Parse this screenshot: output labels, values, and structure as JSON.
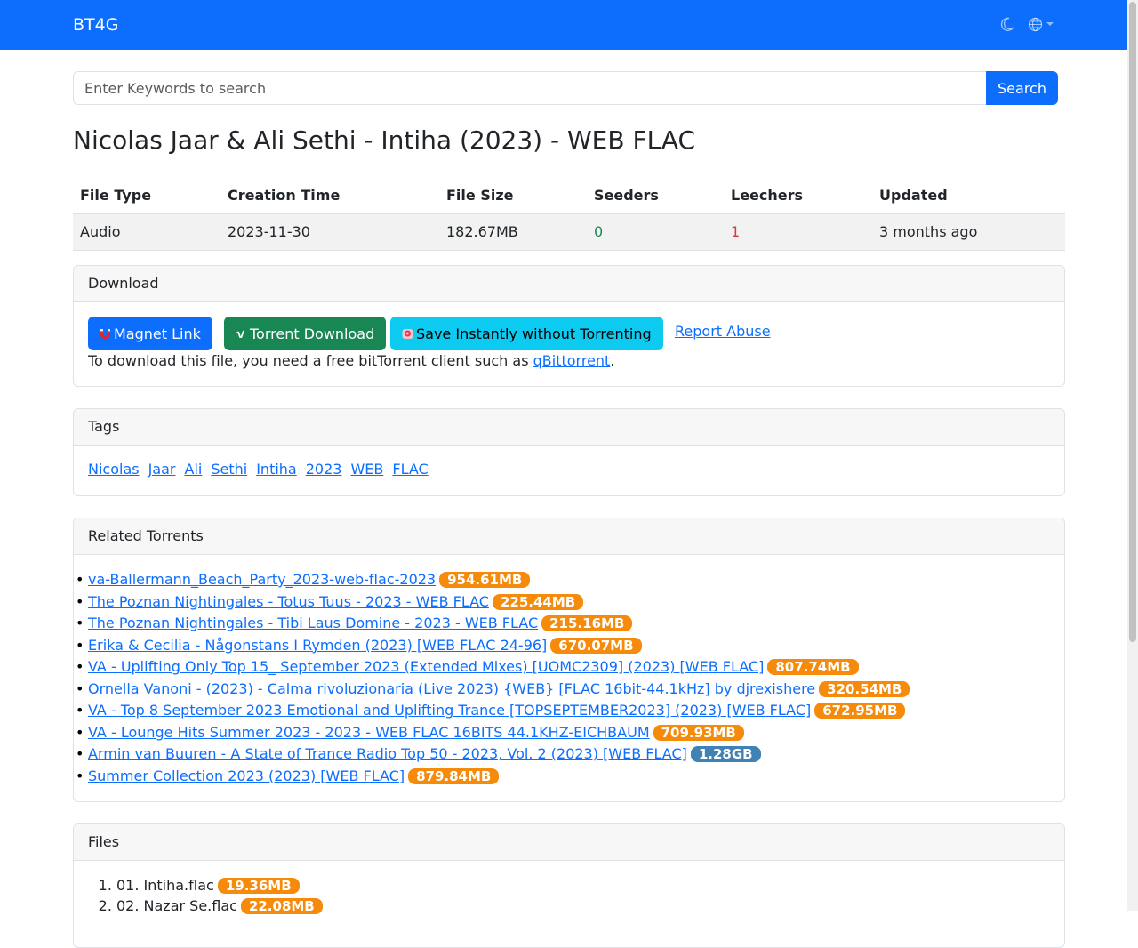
{
  "navbar": {
    "brand": "BT4G",
    "theme_icon": "moon-icon",
    "language_icon": "globe-icon"
  },
  "search": {
    "placeholder": "Enter Keywords to search",
    "value": "",
    "button_label": "Search"
  },
  "title": "Nicolas Jaar & Ali Sethi - Intiha (2023) - WEB FLAC",
  "info_table": {
    "headers": [
      "File Type",
      "Creation Time",
      "File Size",
      "Seeders",
      "Leechers",
      "Updated"
    ],
    "row": [
      "Audio",
      "2023-11-30",
      "182.67MB",
      "0",
      "1",
      "3 months ago"
    ],
    "colors": {
      "seeders": "#198754",
      "leechers": "#dc3545"
    }
  },
  "download": {
    "header": "Download",
    "magnet_label": "Magnet Link",
    "torrent_label": "Torrent Download",
    "instant_label": "Save Instantly without Torrenting",
    "report_label": "Report Abuse",
    "note_prefix": "To download this file, you need a free bitTorrent client such as ",
    "client_link": "qBittorrent",
    "note_suffix": "."
  },
  "tags": {
    "header": "Tags",
    "items": [
      "Nicolas",
      "Jaar",
      "Ali",
      "Sethi",
      "Intiha",
      "2023",
      "WEB",
      "FLAC"
    ]
  },
  "related": {
    "header": "Related Torrents",
    "items": [
      {
        "title": "va-Ballermann_Beach_Party_2023-web-flac-2023",
        "size": "954.61MB",
        "color": "orange"
      },
      {
        "title": "The Poznan Nightingales - Totus Tuus - 2023 - WEB FLAC",
        "size": "225.44MB",
        "color": "orange"
      },
      {
        "title": "The Poznan Nightingales - Tibi Laus Domine - 2023 - WEB FLAC",
        "size": "215.16MB",
        "color": "orange"
      },
      {
        "title": "Erika & Cecilia - Någonstans I Rymden (2023) [WEB FLAC 24-96]",
        "size": "670.07MB",
        "color": "orange"
      },
      {
        "title": "VA - Uplifting Only Top 15_ September 2023 (Extended Mixes) [UOMC2309] (2023) [WEB FLAC]",
        "size": "807.74MB",
        "color": "orange"
      },
      {
        "title": "Ornella Vanoni - (2023) - Calma rivoluzionaria (Live 2023) {WEB} [FLAC 16bit-44.1kHz] by djrexishere",
        "size": "320.54MB",
        "color": "orange"
      },
      {
        "title": "VA - Top 8 September 2023 Emotional and Uplifting Trance [TOPSEPTEMBER2023] (2023) [WEB FLAC]",
        "size": "672.95MB",
        "color": "orange"
      },
      {
        "title": "VA - Lounge Hits Summer 2023 - 2023 - WEB FLAC 16BITS 44.1KHZ-EICHBAUM",
        "size": "709.93MB",
        "color": "orange"
      },
      {
        "title": "Armin van Buuren - A State of Trance Radio Top 50 - 2023, Vol. 2 (2023) [WEB FLAC]",
        "size": "1.28GB",
        "color": "blue"
      },
      {
        "title": "Summer Collection 2023 (2023) [WEB FLAC]",
        "size": "879.84MB",
        "color": "orange"
      }
    ]
  },
  "files": {
    "header": "Files",
    "items": [
      {
        "name": "01. Intiha.flac",
        "size": "19.36MB"
      },
      {
        "name": "02. Nazar Se.flac",
        "size": "22.08MB"
      }
    ]
  },
  "colors": {
    "primary": "#0d6efd",
    "success": "#198754",
    "info": "#0dcaf0",
    "badge_orange": "#f58a0b",
    "badge_blue": "#3f82b3"
  }
}
